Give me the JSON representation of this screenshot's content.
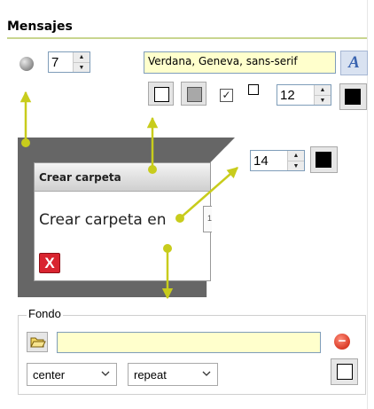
{
  "section": {
    "title": "Mensajes"
  },
  "border": {
    "width_value": "7"
  },
  "font": {
    "family_value": "Verdana, Geneva, sans-serif",
    "style_button_glyph": "A"
  },
  "text_style": {
    "checkbox_mark": "✓",
    "size_value": "12",
    "color": "#000000"
  },
  "header": {
    "size_value": "14",
    "color": "#000000"
  },
  "preview": {
    "header_text": "Crear carpeta",
    "body_text": "Crear carpeta en",
    "field_text": "1",
    "close_glyph": "X"
  },
  "background": {
    "legend": "Fondo",
    "url_value": "",
    "remove_glyph": "−",
    "position_selected": "center",
    "repeat_selected": "repeat"
  },
  "colors": {
    "accent_line": "#c9d58f",
    "guide": "#c8cc1c",
    "field_bg": "#ffffcc"
  },
  "icons": [
    "radio-icon",
    "font-icon",
    "checkbox-icon",
    "folder-icon",
    "remove-icon",
    "close-icon",
    "chevron-down-icon"
  ]
}
